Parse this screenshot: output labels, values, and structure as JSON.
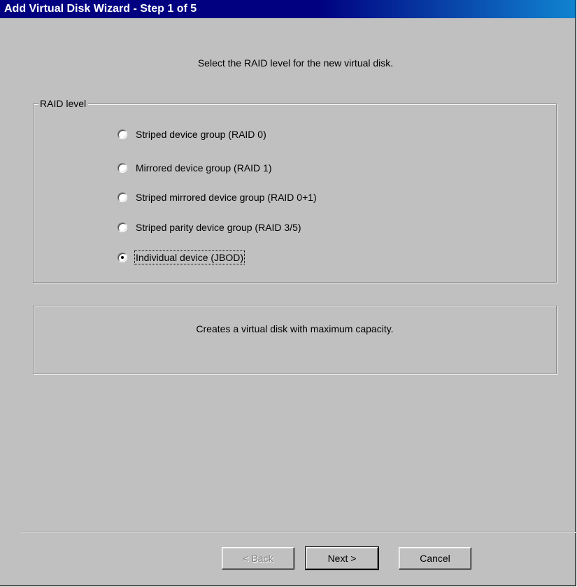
{
  "window": {
    "title": "Add Virtual Disk Wizard - Step 1 of 5"
  },
  "instruction": "Select the RAID level for the new virtual disk.",
  "raid_group": {
    "legend": "RAID level",
    "options": [
      {
        "label": "Striped device group (RAID 0)",
        "selected": false
      },
      {
        "label": "Mirrored device group (RAID 1)",
        "selected": false
      },
      {
        "label": "Striped mirrored device group (RAID 0+1)",
        "selected": false
      },
      {
        "label": "Striped parity device group (RAID 3/5)",
        "selected": false
      },
      {
        "label": "Individual device (JBOD)",
        "selected": true
      }
    ]
  },
  "description": "Creates a virtual disk with maximum capacity.",
  "buttons": {
    "back": "< Back",
    "next": "Next >",
    "cancel": "Cancel"
  },
  "colors": {
    "titlebar": "#000080",
    "face": "#c0c0c0"
  }
}
